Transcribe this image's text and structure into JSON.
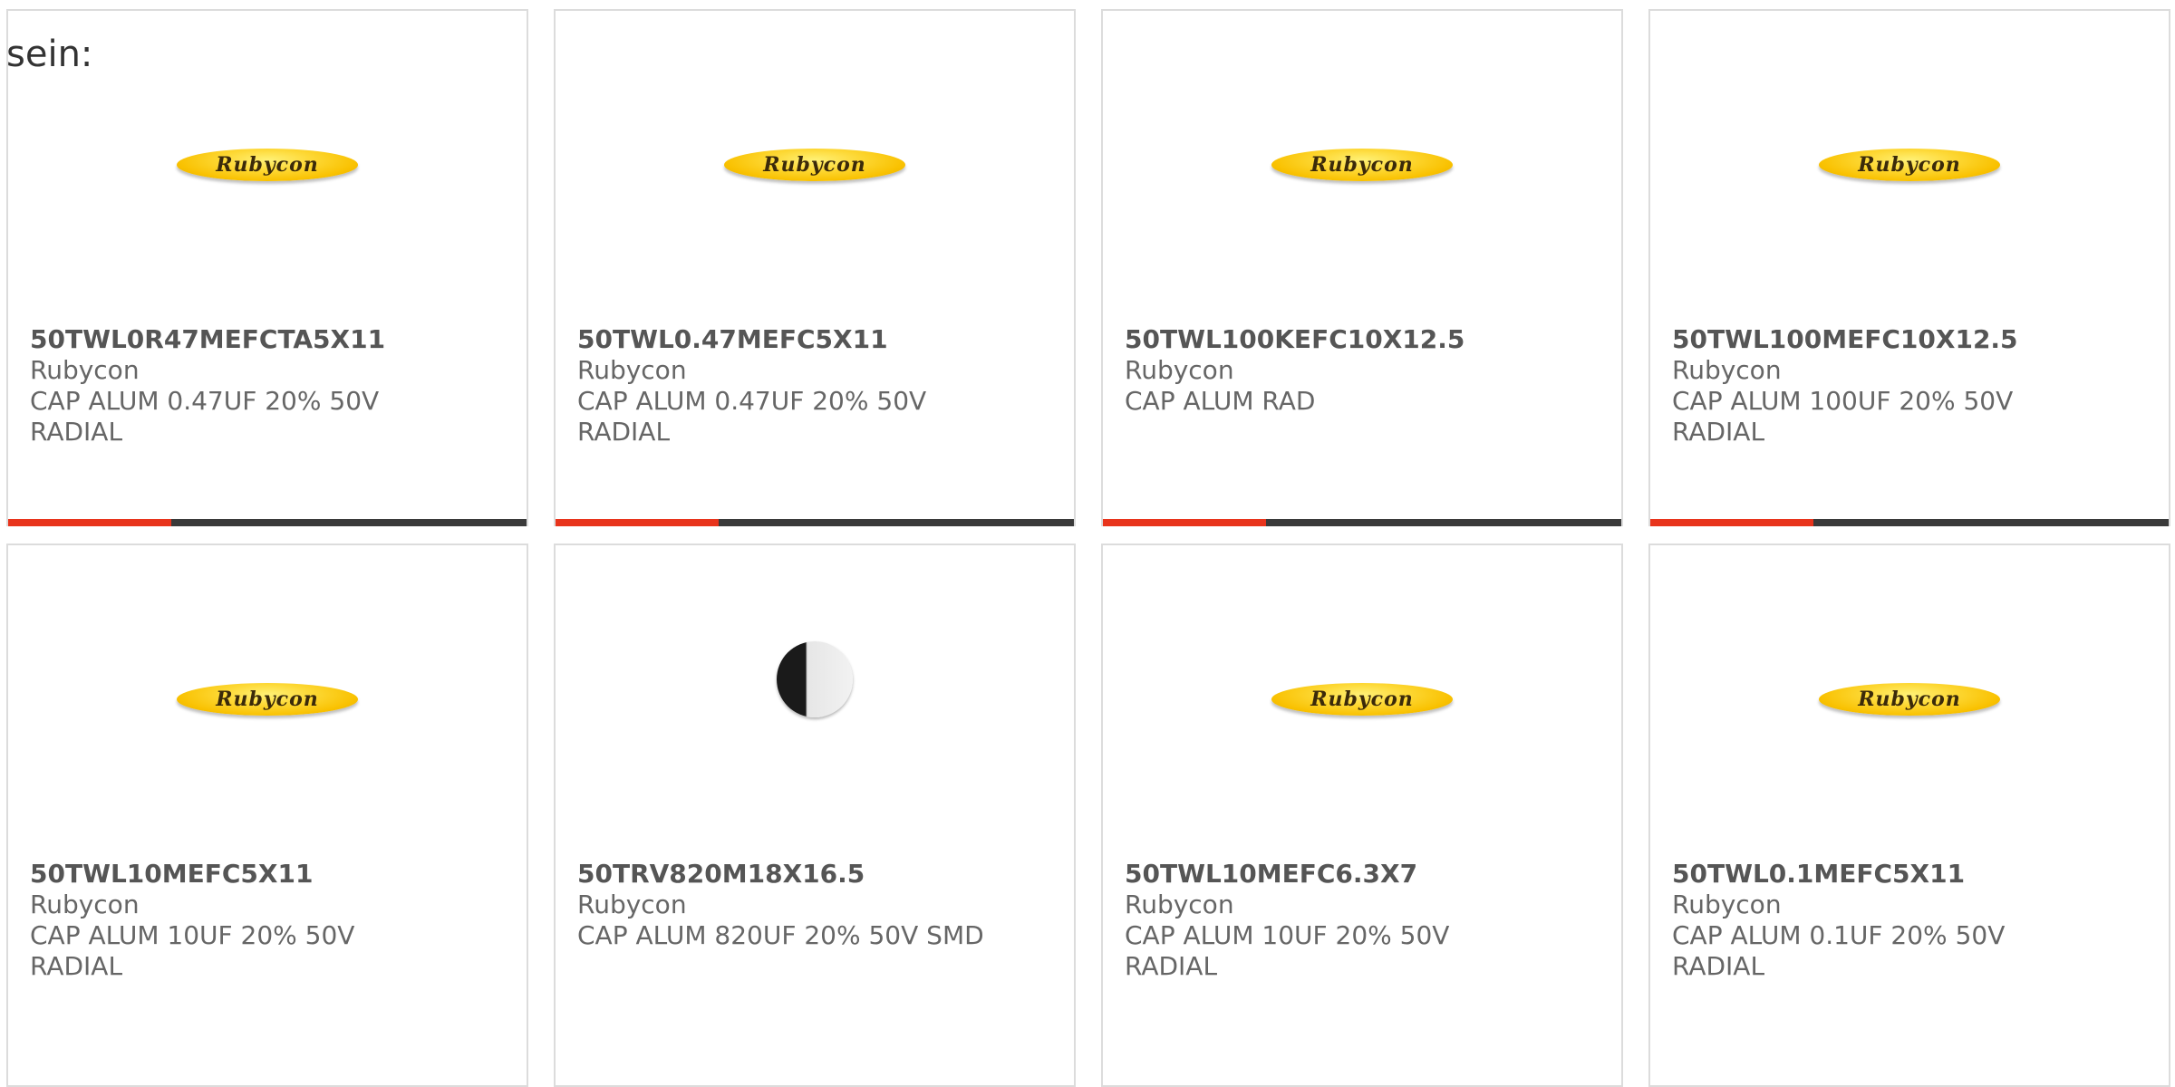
{
  "intro": "sein:",
  "brand_logo_text": "Rubycon",
  "colors": {
    "accent": "#e8341c",
    "bar": "#3a3a3a",
    "logo": "#f9c100"
  },
  "products": [
    {
      "part": "50TWL0R47MEFCTA5X11",
      "maker": "Rubycon",
      "desc": "CAP ALUM 0.47UF 20% 50V RADIAL",
      "image": "rubycon-logo"
    },
    {
      "part": "50TWL0.47MEFC5X11",
      "maker": "Rubycon",
      "desc": "CAP ALUM 0.47UF 20% 50V RADIAL",
      "image": "rubycon-logo"
    },
    {
      "part": "50TWL100KEFC10X12.5",
      "maker": "Rubycon",
      "desc": "CAP ALUM RAD",
      "image": "rubycon-logo"
    },
    {
      "part": "50TWL100MEFC10X12.5",
      "maker": "Rubycon",
      "desc": "CAP ALUM 100UF 20% 50V RADIAL",
      "image": "rubycon-logo"
    },
    {
      "part": "50TWL10MEFC5X11",
      "maker": "Rubycon",
      "desc": "CAP ALUM 10UF 20% 50V RADIAL",
      "image": "rubycon-logo"
    },
    {
      "part": "50TRV820M18X16.5",
      "maker": "Rubycon",
      "desc": "CAP ALUM 820UF 20% 50V SMD",
      "image": "capacitor-photo"
    },
    {
      "part": "50TWL10MEFC6.3X7",
      "maker": "Rubycon",
      "desc": "CAP ALUM 10UF 20% 50V RADIAL",
      "image": "rubycon-logo"
    },
    {
      "part": "50TWL0.1MEFC5X11",
      "maker": "Rubycon",
      "desc": "CAP ALUM 0.1UF 20% 50V RADIAL",
      "image": "rubycon-logo"
    }
  ]
}
